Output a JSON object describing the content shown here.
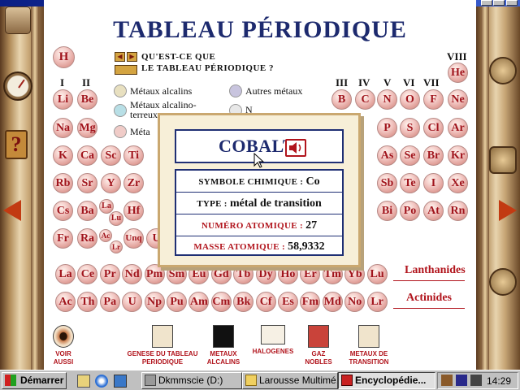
{
  "title": "TABLEAU PÉRIODIQUE",
  "help": {
    "line1": "QU'EST-CE QUE",
    "line2": "LE TABLEAU PÉRIODIQUE ?"
  },
  "groups": {
    "g1": "I",
    "g2": "II",
    "g3": "III",
    "g4": "IV",
    "g5": "V",
    "g6": "VI",
    "g7": "VII",
    "g8": "VIII"
  },
  "legend": [
    {
      "label": "Métaux alcalins",
      "color": "#e8e0c0"
    },
    {
      "label": "Autres métaux",
      "color": "#c8c4de"
    },
    {
      "label": "Métaux alcalino-",
      "color": "#b8dfe6"
    },
    {
      "label": "terreux",
      "color": ""
    },
    {
      "label": "N",
      "color": ""
    },
    {
      "label": "Méta",
      "color": "#f0ccc8"
    }
  ],
  "elements": {
    "H": "H",
    "He": "He",
    "Li": "Li",
    "Be": "Be",
    "B": "B",
    "C": "C",
    "N": "N",
    "O": "O",
    "F": "F",
    "Ne": "Ne",
    "Na": "Na",
    "Mg": "Mg",
    "P": "P",
    "S": "S",
    "Cl": "Cl",
    "Ar": "Ar",
    "K": "K",
    "Ca": "Ca",
    "Sc": "Sc",
    "Ti": "Ti",
    "As": "As",
    "Se": "Se",
    "Br": "Br",
    "Kr": "Kr",
    "Rb": "Rb",
    "Sr": "Sr",
    "Y": "Y",
    "Zr": "Zr",
    "Sb": "Sb",
    "Te": "Te",
    "I": "I",
    "Xe": "Xe",
    "Cs": "Cs",
    "Ba": "Ba",
    "La": "La",
    "Lu": "Lu",
    "Hf": "Hf",
    "Bi": "Bi",
    "Po": "Po",
    "At": "At",
    "Rn": "Rn",
    "Fr": "Fr",
    "Ra": "Ra",
    "Ac": "Ac",
    "Lr": "Lr",
    "Unq": "Unq",
    "U": "U",
    "lanthanides": [
      "La",
      "Ce",
      "Pr",
      "Nd",
      "Pm",
      "Sm",
      "Eu",
      "Gd",
      "Tb",
      "Dy",
      "Ho",
      "Er",
      "Tm",
      "Yb",
      "Lu"
    ],
    "actinides": [
      "Ac",
      "Th",
      "Pa",
      "U",
      "Np",
      "Pu",
      "Am",
      "Cm",
      "Bk",
      "Cf",
      "Es",
      "Fm",
      "Md",
      "No",
      "Lr"
    ]
  },
  "series": {
    "lanthanides": "Lanthanides",
    "actinides": "Actinides"
  },
  "popup": {
    "name": "COBALT",
    "symbol_label": "SYMBOLE CHIMIQUE :",
    "symbol": "Co",
    "type_label": "TYPE :",
    "type": "métal de transition",
    "number_label": "NUMÉRO ATOMIQUE :",
    "number": "27",
    "mass_label": "MASSE ATOMIQUE :",
    "mass": "58,9332"
  },
  "bottom": [
    {
      "line1": "VOIR",
      "line2": "AUSSI"
    },
    {
      "line1": "GENESE DU TABLEAU",
      "line2": "PERIODIQUE"
    },
    {
      "line1": "METAUX",
      "line2": "ALCALINS"
    },
    {
      "line1": "HALOGENES",
      "line2": ""
    },
    {
      "line1": "GAZ",
      "line2": "NOBLES"
    },
    {
      "line1": "METAUX DE",
      "line2": "TRANSITION"
    }
  ],
  "taskbar": {
    "start": "Démarrer",
    "task1": "Dkmmscie (D:)",
    "task2": "Larousse Multimé...",
    "task3": "Encyclopédie...",
    "clock": "14:29"
  }
}
